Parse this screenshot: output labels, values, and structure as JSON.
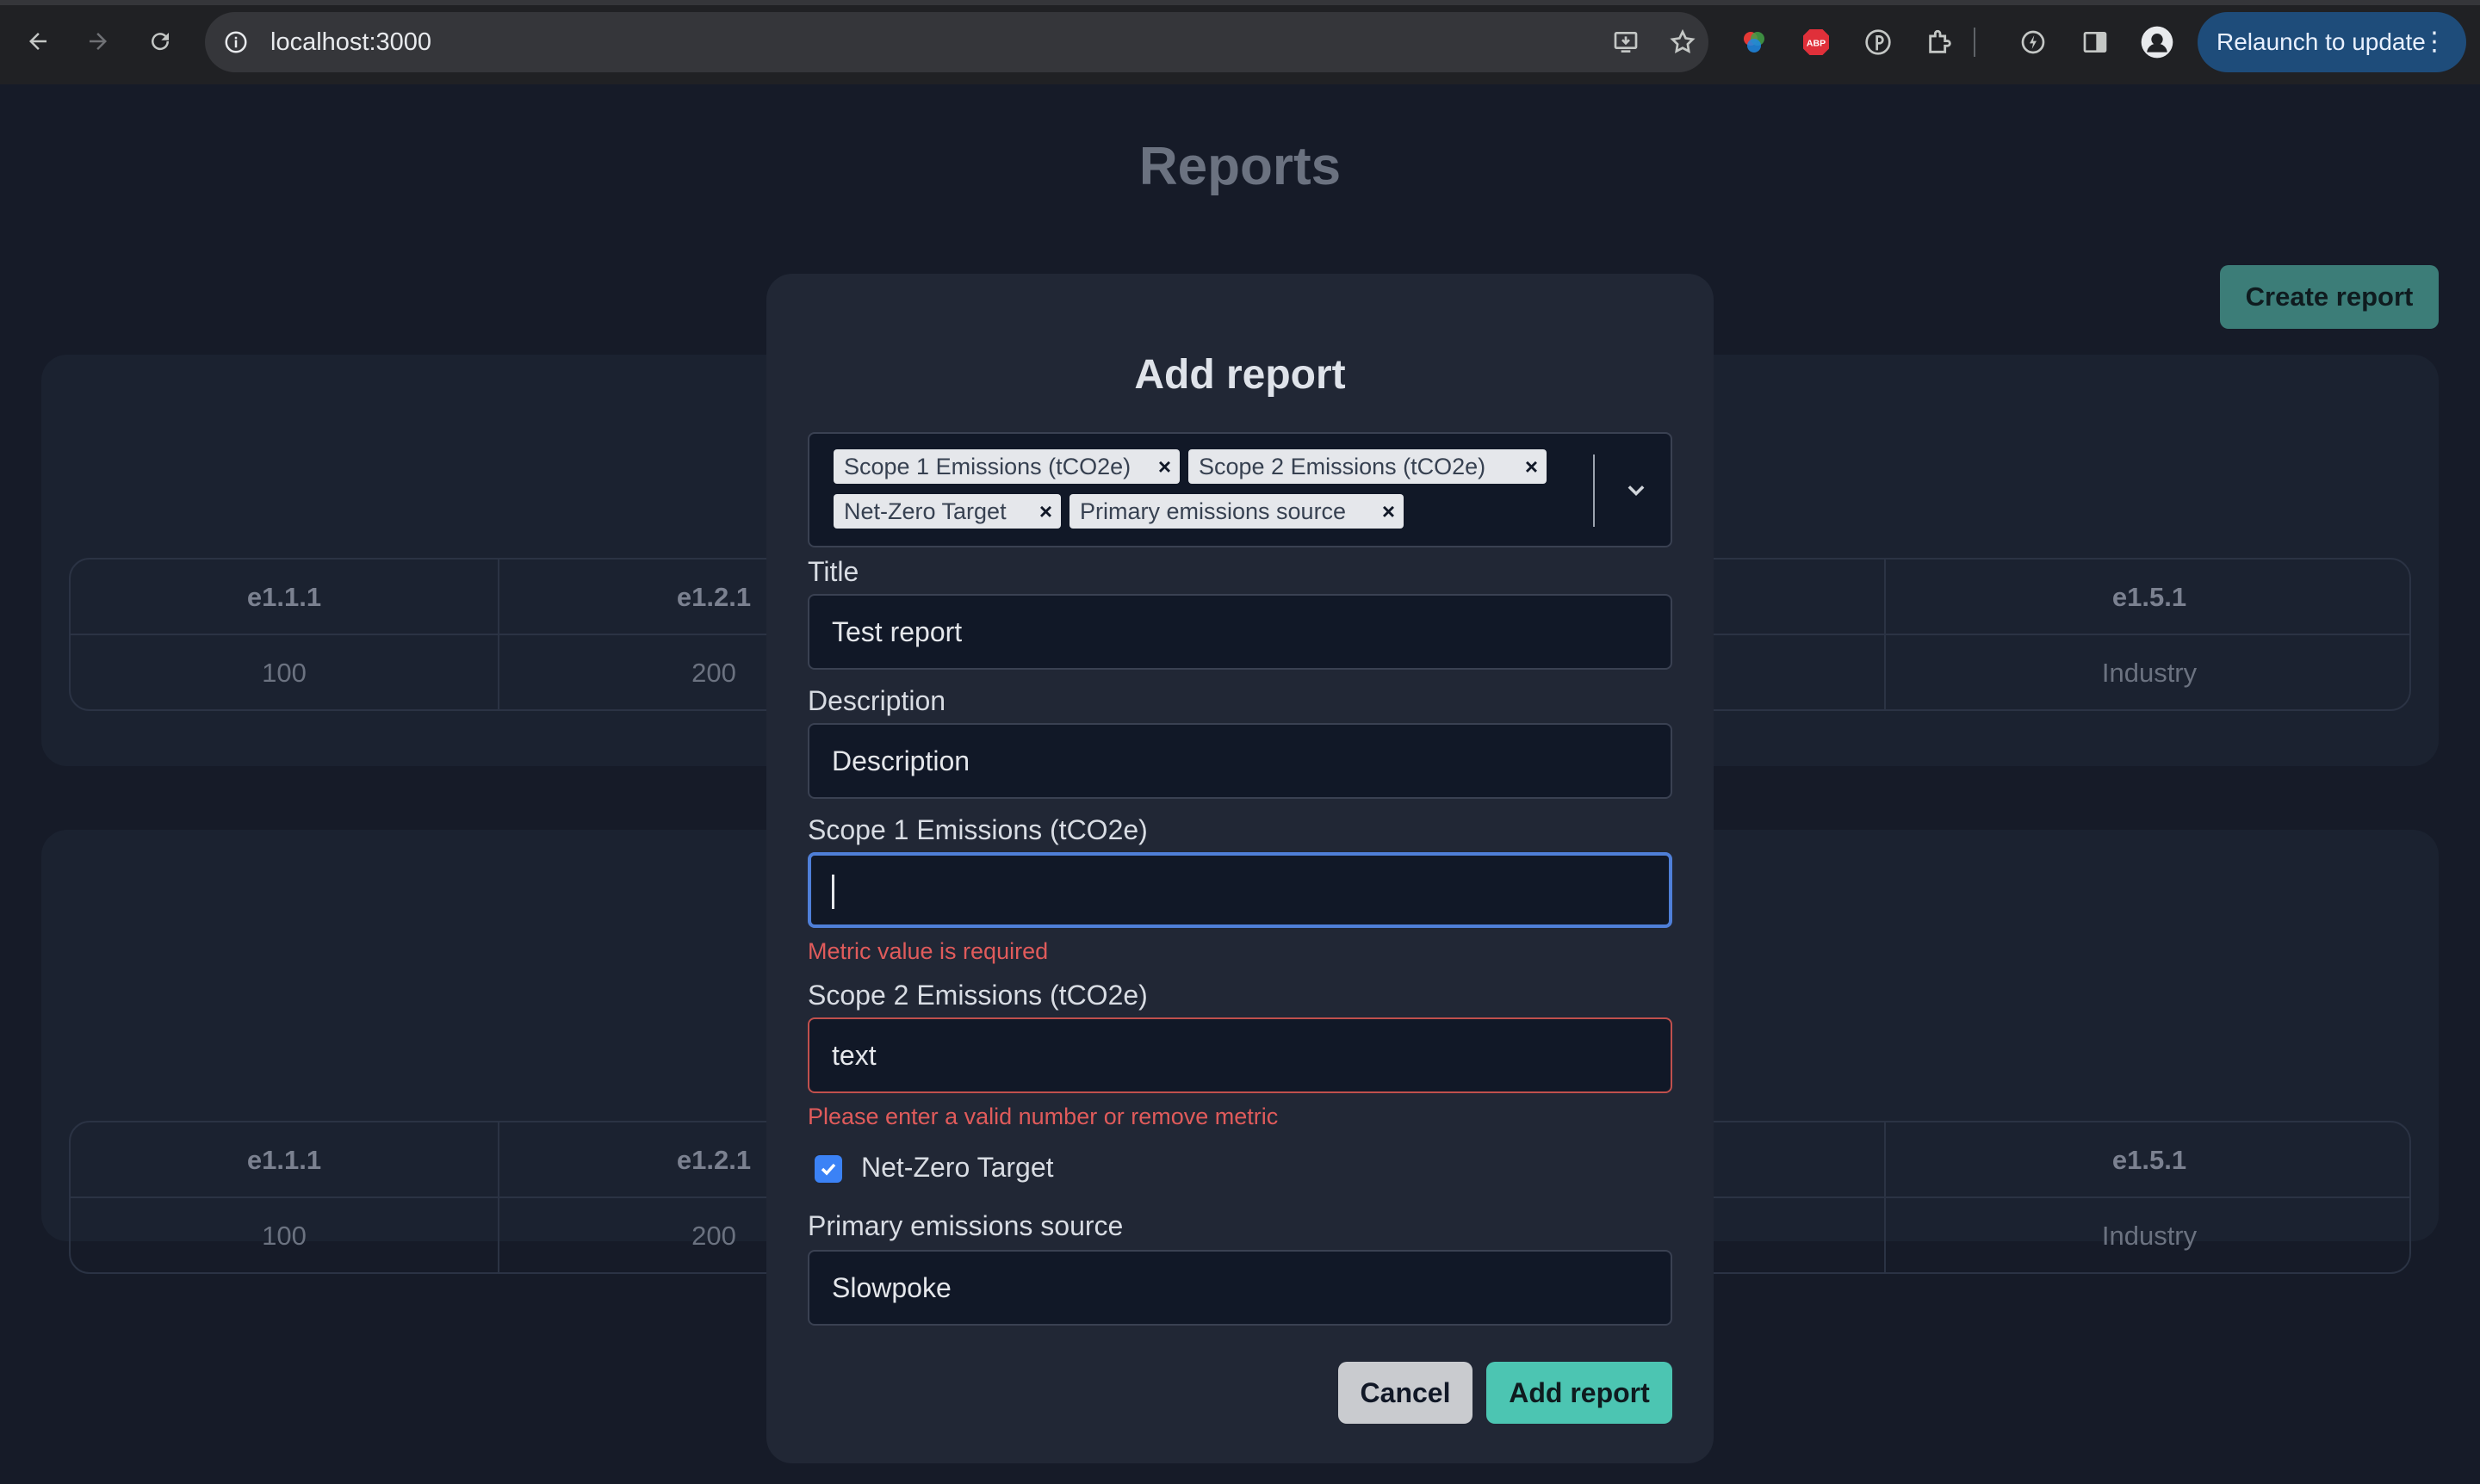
{
  "browser": {
    "url": "localhost:3000",
    "relaunch_label": "Relaunch to update",
    "abp_label": "ABP"
  },
  "page": {
    "title": "Reports",
    "create_button": "Create report",
    "tables": [
      {
        "headers": [
          "e1.1.1",
          "e1.2.1",
          "e1.5.1"
        ],
        "values": [
          "100",
          "200",
          "Industry"
        ]
      },
      {
        "headers": [
          "e1.1.1",
          "e1.2.1",
          "e1.5.1"
        ],
        "values": [
          "100",
          "200",
          "Industry"
        ]
      }
    ]
  },
  "modal": {
    "title": "Add report",
    "selected_metrics": [
      "Scope 1 Emissions (tCO2e)",
      "Scope 2 Emissions (tCO2e)",
      "Net-Zero Target",
      "Primary emissions source"
    ],
    "chip_remove": "×",
    "fields": {
      "title": {
        "label": "Title",
        "value": "Test report"
      },
      "description": {
        "label": "Description",
        "value": "Description"
      },
      "scope1": {
        "label": "Scope 1 Emissions (tCO2e)",
        "value": "",
        "error": "Metric value is required"
      },
      "scope2": {
        "label": "Scope 2 Emissions (tCO2e)",
        "value": "text",
        "error": "Please enter a valid number or remove metric"
      },
      "net_zero": {
        "label": "Net-Zero Target",
        "checked": true
      },
      "primary_source": {
        "label": "Primary emissions source",
        "value": "Slowpoke"
      }
    },
    "cancel_button": "Cancel",
    "add_button": "Add report"
  },
  "colors": {
    "accent_teal": "#4cc5b2",
    "error_red": "#e05b5b",
    "focus_blue": "#4f7fd8"
  }
}
